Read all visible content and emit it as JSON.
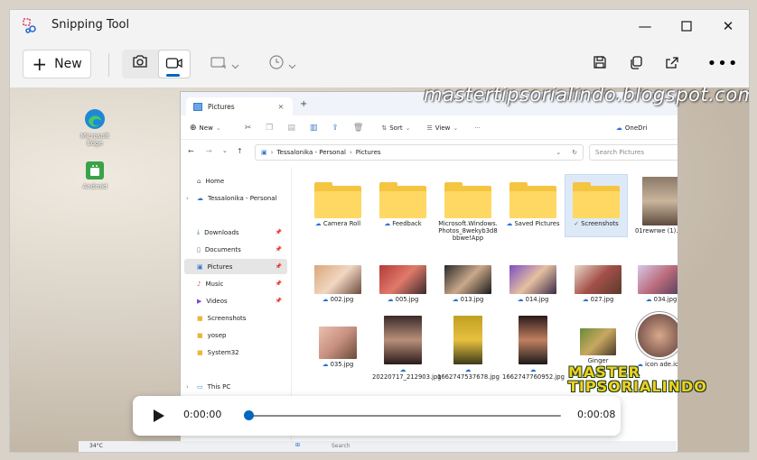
{
  "window": {
    "title": "Snipping Tool",
    "controls": {
      "minimize": "—",
      "maximize": "☐",
      "close": "✕"
    }
  },
  "toolbar": {
    "new_label": "New",
    "screenshot_mode_icon": "camera-icon",
    "record_mode_icon": "video-camera-icon",
    "shape_icon": "rectangle-mode-icon",
    "delay_icon": "timer-icon",
    "save_icon": "save-icon",
    "copy_icon": "copy-icon",
    "share_icon": "share-icon",
    "more_icon": "more-icon",
    "accent": "#0067c0"
  },
  "capture": {
    "watermark": "mastertipsorialindo.blogspot.com",
    "brand_line1": "MASTER",
    "brand_line2": "TIPSORIALINDO",
    "desktop_icons": [
      {
        "label": "Microsoft Edge"
      },
      {
        "label": "Android"
      }
    ],
    "explorer": {
      "tab_title": "Pictures",
      "commands": {
        "new": "New",
        "sort": "Sort",
        "view": "View",
        "onedrive": "OneDri"
      },
      "breadcrumb": [
        "Tessalonika - Personal",
        "Pictures"
      ],
      "search_placeholder": "Search Pictures",
      "nav": [
        {
          "label": "Home",
          "pinned": false
        },
        {
          "label": "Tessalonika - Personal",
          "pinned": false
        },
        {
          "label": "Downloads",
          "pinned": true
        },
        {
          "label": "Documents",
          "pinned": true
        },
        {
          "label": "Pictures",
          "pinned": true,
          "selected": true
        },
        {
          "label": "Music",
          "pinned": true
        },
        {
          "label": "Videos",
          "pinned": true
        },
        {
          "label": "Screenshots",
          "pinned": false
        },
        {
          "label": "yosep",
          "pinned": false
        },
        {
          "label": "System32",
          "pinned": false
        },
        {
          "label": "This PC",
          "pinned": false
        }
      ],
      "folders": [
        {
          "name": "Camera Roll"
        },
        {
          "name": "Feedback"
        },
        {
          "name": "Microsoft.Windows.Photos_8wekyb3d8bbwe!App"
        },
        {
          "name": "Saved Pictures"
        },
        {
          "name": "Screenshots"
        }
      ],
      "files_row1": [
        "01rewrwe (1).jpg"
      ],
      "files_row2": [
        "002.jpg",
        "005.jpg",
        "013.jpg",
        "014.jpg",
        "027.jpg",
        "034.jpg"
      ],
      "files_row3": [
        "035.jpg",
        "20220717_212903.jpg",
        "1662747537678.jpg",
        "1662747760952.jpg",
        "Ginger",
        "icon ade.ico"
      ]
    },
    "taskbar": {
      "temperature": "34°C",
      "search": "Search"
    }
  },
  "player": {
    "current_time": "0:00:00",
    "total_time": "0:00:08",
    "progress": 0
  }
}
